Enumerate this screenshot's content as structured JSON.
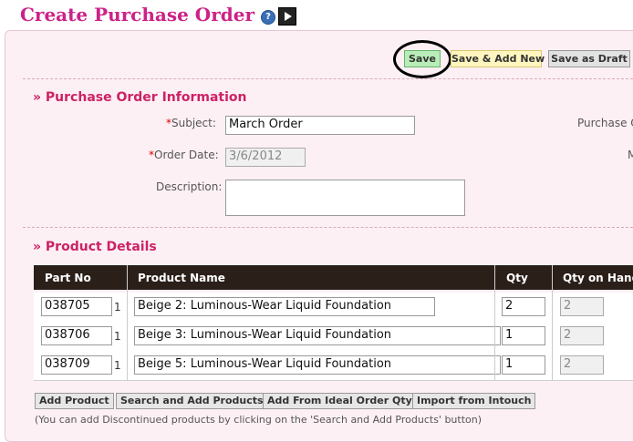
{
  "page": {
    "title": "Create Purchase Order",
    "help_icon": "question-mark-icon",
    "video_icon": "video-icon"
  },
  "toolbar": {
    "save_label": "Save",
    "save_add_label": "Save & Add New",
    "draft_label": "Save as Draft"
  },
  "po_info": {
    "section_title": "» Purchase Order Information",
    "subject_required": "*",
    "subject_label": "Subject:",
    "subject_value": "March Order",
    "order_date_required": "*",
    "order_date_label": "Order Date:",
    "order_date_value": "3/6/2012",
    "description_label": "Description:",
    "description_value": "",
    "right_label_1": "Purchase O",
    "right_label_2": "M"
  },
  "products": {
    "section_title": "» Product Details",
    "columns": [
      "Part No",
      "Product Name",
      "Qty",
      "Qty on Hand"
    ],
    "rows": [
      {
        "part_no": "038705",
        "suffix": "1",
        "name": "Beige 2: Luminous-Wear Liquid Foundation",
        "qty": "2",
        "on_hand": "2"
      },
      {
        "part_no": "038706",
        "suffix": "1",
        "name": "Beige 3: Luminous-Wear Liquid Foundation",
        "qty": "1",
        "on_hand": "2"
      },
      {
        "part_no": "038709",
        "suffix": "1",
        "name": "Beige 5: Luminous-Wear Liquid Foundation",
        "qty": "1",
        "on_hand": "2"
      }
    ]
  },
  "actions": {
    "add_product": "Add Product",
    "search_add": "Search and Add Products",
    "add_ideal": "Add From Ideal Order Qty",
    "import_intouch": "Import from Intouch",
    "note": "(You can add Discontinued products by clicking on the 'Search and Add Products' button)"
  },
  "colors": {
    "title": "#cc2288",
    "section": "#cc2266",
    "panel_bg": "#fdf0f4",
    "table_header": "#2b1f1a"
  }
}
